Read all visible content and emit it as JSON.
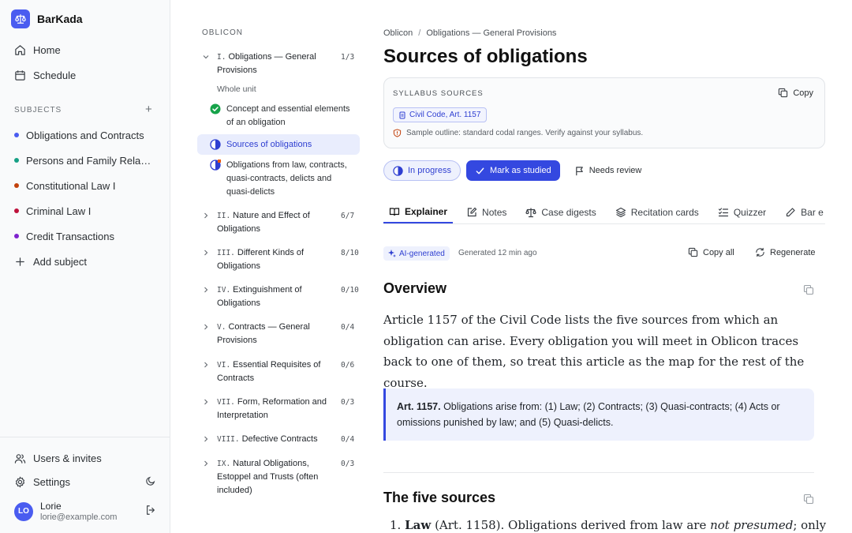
{
  "app": {
    "name": "BarKada"
  },
  "nav": {
    "home": "Home",
    "schedule": "Schedule"
  },
  "subjects": {
    "label": "SUBJECTS",
    "add_icon": "+",
    "items": [
      {
        "name": "Obligations and Contracts",
        "color": "#4a5cf0"
      },
      {
        "name": "Persons and Family Rela…",
        "color": "#16a085"
      },
      {
        "name": "Constitutional Law I",
        "color": "#c2410c"
      },
      {
        "name": "Criminal Law I",
        "color": "#be123c"
      },
      {
        "name": "Credit Transactions",
        "color": "#7e22ce"
      }
    ],
    "add_subject": "Add subject"
  },
  "footer": {
    "users_invites": "Users & invites",
    "settings": "Settings",
    "user": {
      "initials": "LO",
      "name": "Lorie",
      "email": "lorie@example.com"
    }
  },
  "outline": {
    "label": "OBLICON",
    "units": [
      {
        "roman": "I.",
        "title": "Obligations — General Provisions",
        "count": "1/3"
      },
      {
        "roman": "II.",
        "title": "Nature and Effect of Obligations",
        "count": "6/7"
      },
      {
        "roman": "III.",
        "title": "Different Kinds of Obligations",
        "count": "8/10"
      },
      {
        "roman": "IV.",
        "title": "Extinguishment of Obligations",
        "count": "0/10"
      },
      {
        "roman": "V.",
        "title": "Contracts — General Provisions",
        "count": "0/4"
      },
      {
        "roman": "VI.",
        "title": "Essential Requisites of Contracts",
        "count": "0/6"
      },
      {
        "roman": "VII.",
        "title": "Form, Reformation and Interpretation",
        "count": "0/3"
      },
      {
        "roman": "VIII.",
        "title": "Defective Contracts",
        "count": "0/4"
      },
      {
        "roman": "IX.",
        "title": "Natural Obligations, Estoppel and Trusts (often included)",
        "count": "0/3"
      }
    ],
    "whole_unit": "Whole unit",
    "topics": [
      {
        "title": "Concept and essential elements of an obligation",
        "status": "done"
      },
      {
        "title": "Sources of obligations",
        "status": "in-progress"
      },
      {
        "title": "Obligations from law, contracts, quasi-contracts, delicts and quasi-delicts",
        "status": "needs-review"
      }
    ]
  },
  "main": {
    "breadcrumb": {
      "root": "Oblicon",
      "sep": "/",
      "current": "Obligations — General Provisions"
    },
    "title": "Sources of obligations",
    "syllabus": {
      "label": "SYLLABUS SOURCES",
      "copy": "Copy",
      "chip": "Civil Code, Art. 1157",
      "note": "Sample outline: standard codal ranges. Verify against your syllabus."
    },
    "status": {
      "in_progress": "In progress",
      "mark_studied": "Mark as studied",
      "needs_review": "Needs review"
    },
    "tabs": [
      "Explainer",
      "Notes",
      "Case digests",
      "Recitation cards",
      "Quizzer",
      "Bar e"
    ],
    "generated": {
      "badge": "AI-generated",
      "time": "Generated 12 min ago",
      "copy_all": "Copy all",
      "regenerate": "Regenerate"
    },
    "overview": {
      "heading": "Overview",
      "text": "Article 1157 of the Civil Code lists the five sources from which an obligation can arise. Every obligation you will meet in Oblicon traces back to one of them, so treat this article as the map for the rest of the course."
    },
    "quote": {
      "ref": "Art. 1157.",
      "text": "Obligations arise from: (1) Law; (2) Contracts; (3) Quasi-contracts; (4) Acts or omissions punished by law; and (5) Quasi-delicts."
    },
    "five_sources": {
      "heading": "The five sources",
      "item1": {
        "num": "1.",
        "term": "Law",
        "ref": "(Art. 1158). Obligations derived from law are",
        "emph": "not presumed",
        "rest": "; only"
      }
    },
    "colors": {
      "accent": "#3448e0",
      "accent_soft": "#eef1fd",
      "done": "#16a34a",
      "warn": "#ea580c"
    }
  }
}
